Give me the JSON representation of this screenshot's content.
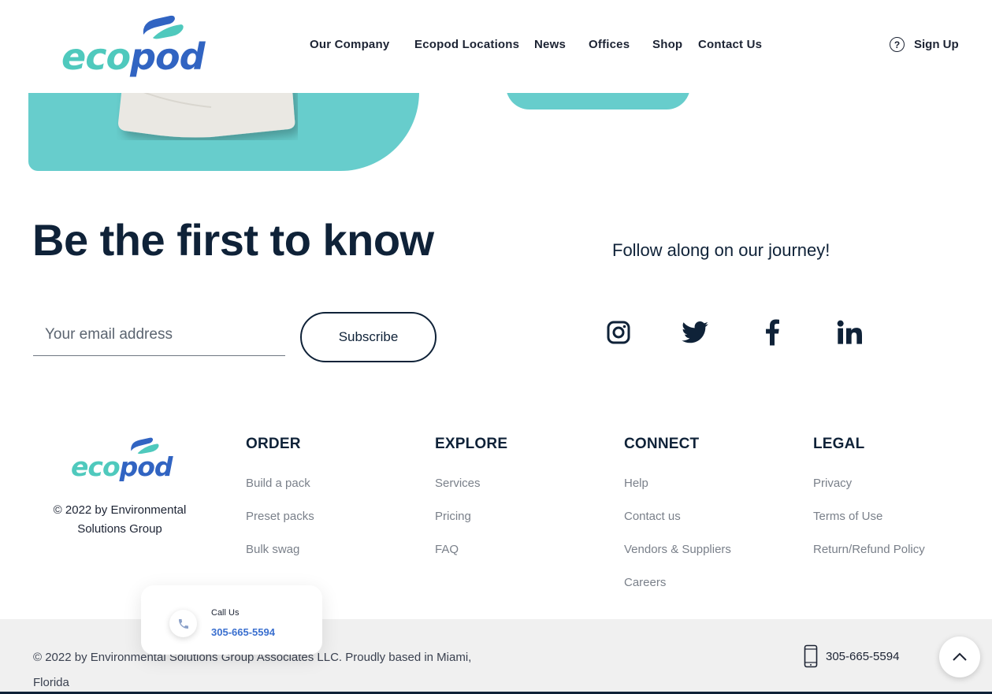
{
  "header": {
    "logo": {
      "eco": "eco",
      "pod": "pod"
    },
    "nav": [
      "Our Company",
      "Ecopod Locations",
      "News",
      "Offices",
      "Shop",
      "Contact Us"
    ],
    "signup_icon": "help-circle-icon",
    "signup_label": "Sign Up"
  },
  "newsletter": {
    "headline": "Be the first to know",
    "email_placeholder": "Your email address",
    "subscribe_label": "Subscribe",
    "follow_text": "Follow along on our journey!",
    "social": [
      "instagram-icon",
      "twitter-icon",
      "facebook-icon",
      "linkedin-icon"
    ]
  },
  "footer": {
    "logo": {
      "eco": "eco",
      "pod": "pod"
    },
    "copyright": "© 2022 by Environmental Solutions Group",
    "columns": [
      {
        "title": "ORDER",
        "links": [
          "Build a pack",
          "Preset packs",
          "Bulk swag"
        ]
      },
      {
        "title": "EXPLORE",
        "links": [
          "Services",
          "Pricing",
          "FAQ"
        ]
      },
      {
        "title": "CONNECT",
        "links": [
          "Help",
          "Contact us",
          "Vendors & Suppliers",
          "Careers"
        ]
      },
      {
        "title": "LEGAL",
        "links": [
          "Privacy",
          "Terms of Use",
          "Return/Refund Policy"
        ]
      }
    ]
  },
  "bottom_bar": {
    "text": "© 2022 by Environmental Solutions Group Associates LLC. Proudly based in Miami, Florida",
    "phone": "305-665-5594",
    "phone_icon": "mobile-phone-icon",
    "to_top_icon": "chevron-up-icon"
  },
  "call_popup": {
    "label": "Call Us",
    "phone": "305-665-5594",
    "icon": "phone-icon"
  },
  "colors": {
    "teal": "#67cdcc",
    "navy": "#0f2238",
    "logo_teal": "#4fc9bd",
    "logo_blue": "#3164c2",
    "link_blue": "#3a6fcf"
  }
}
